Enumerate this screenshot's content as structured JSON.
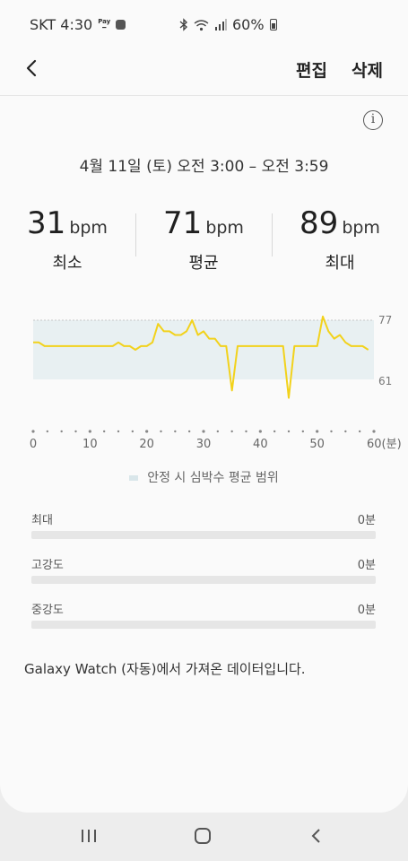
{
  "status_bar": {
    "carrier_time": "SKT 4:30",
    "pay_label": "Pay",
    "battery": "60%"
  },
  "header": {
    "edit_label": "편집",
    "delete_label": "삭제"
  },
  "summary": {
    "time_range": "4월 11일 (토) 오전 3:00 – 오전 3:59",
    "min": {
      "value": "31",
      "unit": "bpm",
      "label": "최소"
    },
    "avg": {
      "value": "71",
      "unit": "bpm",
      "label": "평균"
    },
    "max": {
      "value": "89",
      "unit": "bpm",
      "label": "최대"
    }
  },
  "chart_data": {
    "type": "line",
    "y_range_labels": [
      "77",
      "61"
    ],
    "x_tick_labels": [
      "0",
      "10",
      "20",
      "30",
      "40",
      "50",
      "60(분)"
    ],
    "resting_band": [
      61,
      77
    ],
    "line_color": "#f2d21c",
    "band_color": "#e8f0f2",
    "legend": "안정 시 심박수 평균 범위",
    "series": [
      {
        "x": [
          0,
          1,
          2,
          3,
          4,
          5,
          6,
          7,
          8,
          9,
          10,
          11,
          12,
          13,
          14,
          15,
          16,
          17,
          18,
          19,
          20,
          21,
          22,
          23,
          24,
          25,
          26,
          27,
          28,
          29,
          30,
          31,
          32,
          33,
          34,
          35,
          36,
          37,
          38,
          39,
          40,
          41,
          42,
          43,
          44,
          45,
          46,
          47,
          48,
          49,
          50,
          51,
          52,
          53,
          54,
          55,
          56,
          57,
          58,
          59
        ],
        "y": [
          71,
          71,
          70,
          70,
          70,
          70,
          70,
          70,
          70,
          70,
          70,
          70,
          70,
          70,
          70,
          71,
          70,
          70,
          69,
          70,
          70,
          71,
          76,
          74,
          74,
          73,
          73,
          74,
          77,
          73,
          74,
          72,
          72,
          70,
          70,
          58,
          70,
          70,
          70,
          70,
          70,
          70,
          70,
          70,
          70,
          56,
          70,
          70,
          70,
          70,
          70,
          78,
          74,
          72,
          73,
          71,
          70,
          70,
          70,
          69
        ]
      }
    ]
  },
  "intensity": [
    {
      "name": "최대",
      "amount": "0분",
      "fraction": 0
    },
    {
      "name": "고강도",
      "amount": "0분",
      "fraction": 0
    },
    {
      "name": "중강도",
      "amount": "0분",
      "fraction": 0
    }
  ],
  "source_note": "Galaxy Watch (자동)에서 가져온 데이터입니다."
}
